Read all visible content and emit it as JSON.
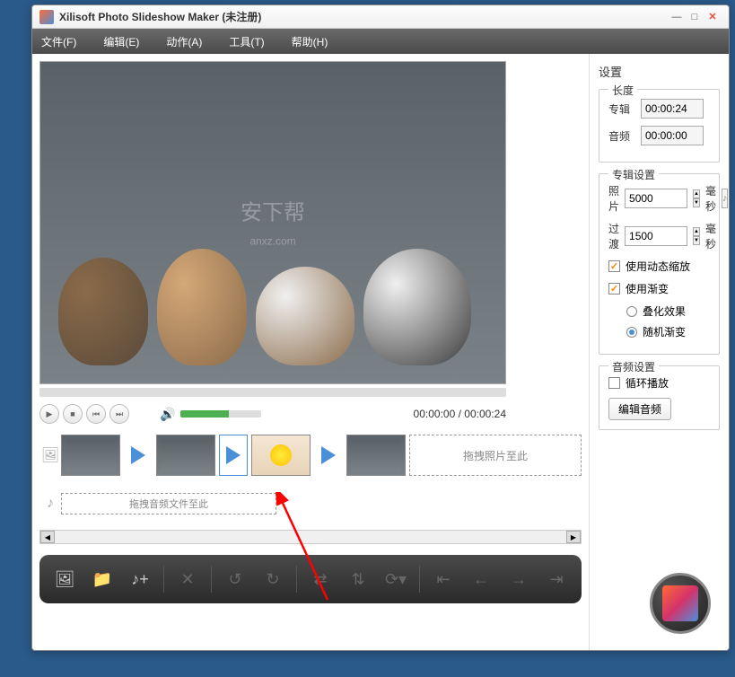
{
  "window": {
    "title": "Xilisoft Photo Slideshow Maker (未注册)"
  },
  "menu": {
    "file": "文件(F)",
    "edit": "编辑(E)",
    "action": "动作(A)",
    "tools": "工具(T)",
    "help": "帮助(H)"
  },
  "playback": {
    "current_time": "00:00:00",
    "total_time": "00:00:24"
  },
  "timeline": {
    "photo_drop_hint": "拖拽照片至此",
    "audio_drop_hint": "拖拽音频文件至此"
  },
  "settings": {
    "title": "设置",
    "length": {
      "legend": "长度",
      "album_label": "专辑",
      "album_value": "00:00:24",
      "audio_label": "音频",
      "audio_value": "00:00:00"
    },
    "album": {
      "legend": "专辑设置",
      "photo_label": "照片",
      "photo_value": "5000",
      "transition_label": "过渡",
      "transition_value": "1500",
      "unit": "毫秒",
      "use_zoom": "使用动态缩放",
      "use_transition": "使用渐变",
      "stack_effect": "叠化效果",
      "random_transition": "随机渐变"
    },
    "audio": {
      "legend": "音频设置",
      "loop": "循环播放",
      "edit_button": "编辑音频"
    }
  }
}
